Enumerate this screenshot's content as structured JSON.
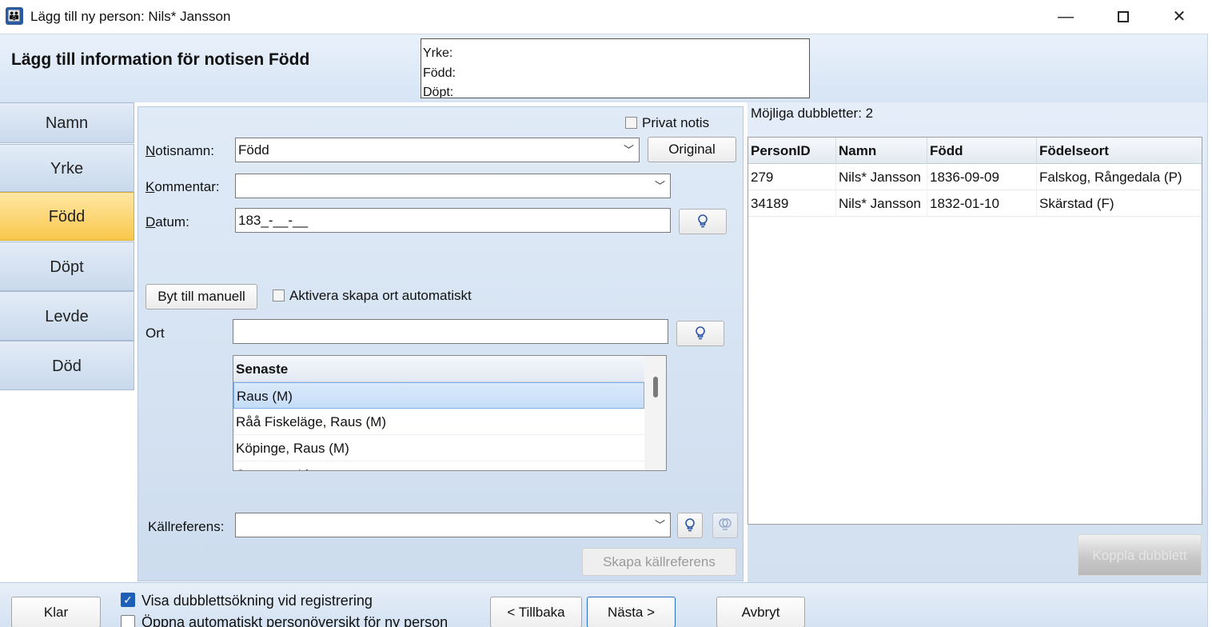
{
  "window": {
    "title": "Lägg till ny person: Nils* Jansson",
    "app_icon_glyph": "👪",
    "minimize": "—",
    "close": "✕"
  },
  "header": {
    "title": "Lägg till information för notisen Född",
    "preview_lines": [
      "Yrke:",
      "Född:",
      "Döpt:"
    ]
  },
  "nav": {
    "items": [
      {
        "label": "Namn"
      },
      {
        "label": "Yrke"
      },
      {
        "label": "Född",
        "active": true
      },
      {
        "label": "Döpt"
      },
      {
        "label": "Levde"
      },
      {
        "label": "Död"
      }
    ]
  },
  "form": {
    "private_label": "Privat notis",
    "notisnamn_label_first": "N",
    "notisnamn_label_rest": "otisnamn:",
    "notisnamn_value": "Född",
    "original_button": "Original",
    "kommentar_label_first": "K",
    "kommentar_label_rest": "ommentar:",
    "kommentar_value": "",
    "datum_label_first": "D",
    "datum_label_rest": "atum:",
    "datum_value": "183_-__-__",
    "switch_manual_button": "Byt till manuell",
    "auto_place_label": "Aktivera skapa ort automatiskt",
    "ort_label": "Ort",
    "ort_value": "",
    "recent_header": "Senaste",
    "recent_items": [
      "Raus (M)",
      "Råå Fiskeläge, Raus (M)",
      "Köpinge, Raus (M)",
      "Stampen, Ljung"
    ],
    "kallref_label_first": "K",
    "kallref_label_rest": "ällreferens:",
    "kallref_value": "",
    "create_source_button": "Skapa källreferens",
    "chevron": "﹀"
  },
  "duplicates": {
    "title": "Möjliga dubbletter: 2",
    "columns": [
      "PersonID",
      "Namn",
      "Född",
      "Födelseort"
    ],
    "rows": [
      [
        "279",
        "Nils* Jansson",
        "1836-09-09",
        "Falskog, Rångedala (P)"
      ],
      [
        "34189",
        "Nils* Jansson",
        "1832-01-10",
        "Skärstad (F)"
      ]
    ],
    "link_button": "Koppla dubblett"
  },
  "footer": {
    "done_button": "Klar",
    "show_dup_label": "Visa dubblettsökning vid registrering",
    "show_dup_checked": "✓",
    "open_overview_label": "Öppna automatiskt personöversikt för ny person",
    "back_button": "< Tillbaka",
    "next_button": "Nästa >",
    "cancel_button": "Avbryt"
  },
  "colors": {
    "accent": "#1e6fcf",
    "active_tab": "#f9c84c",
    "panel_bg": "#d6e4f4"
  }
}
